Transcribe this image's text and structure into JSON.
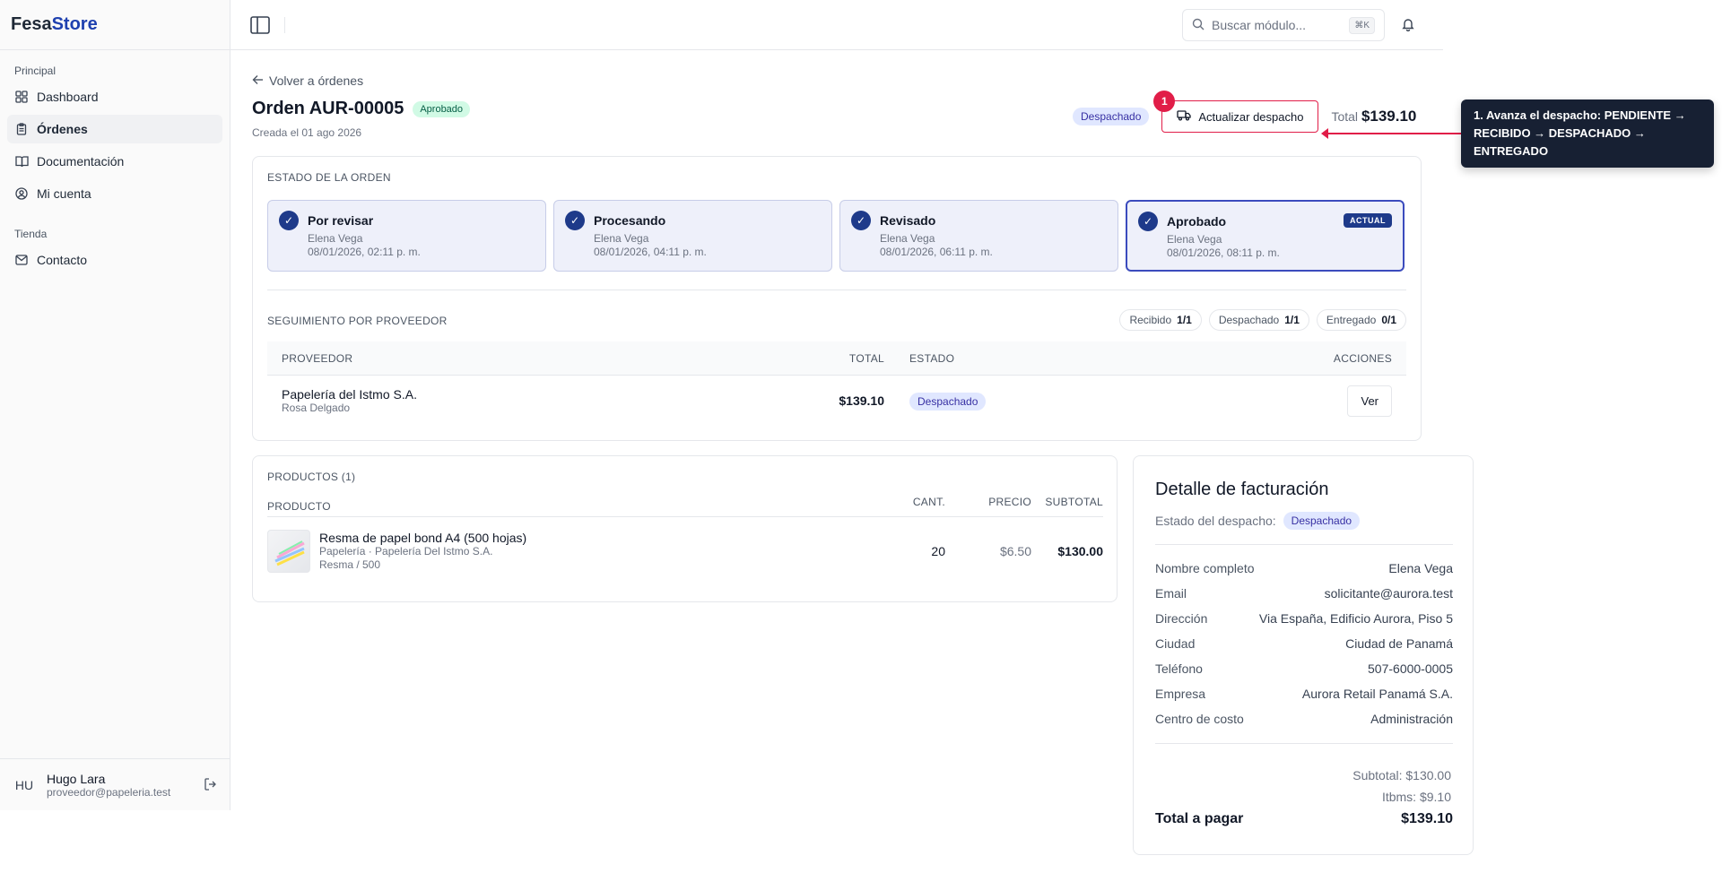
{
  "brand": {
    "part1": "Fesa",
    "part2": "Store"
  },
  "sidebar": {
    "group1_label": "Principal",
    "group1_items": [
      {
        "label": "Dashboard",
        "icon": "grid-icon"
      },
      {
        "label": "Órdenes",
        "icon": "clipboard-icon",
        "active": true
      },
      {
        "label": "Documentación",
        "icon": "book-icon"
      },
      {
        "label": "Mi cuenta",
        "icon": "user-circle-icon"
      }
    ],
    "group2_label": "Tienda",
    "group2_items": [
      {
        "label": "Contacto",
        "icon": "mail-icon"
      }
    ]
  },
  "user": {
    "initials": "HU",
    "name": "Hugo Lara",
    "email": "proveedor@papeleria.test"
  },
  "topbar": {
    "search_placeholder": "Buscar módulo...",
    "search_shortcut": "⌘K"
  },
  "header": {
    "back_label": "Volver a órdenes",
    "order_title": "Orden AUR-00005",
    "order_badge": "Aprobado",
    "created": "Creada el 01 ago 2026",
    "dispatch_badge": "Despachado",
    "update_button": "Actualizar despacho",
    "step_number": "1",
    "total_label": "Total",
    "total_value": "$139.10"
  },
  "tooltip": {
    "text": "1. Avanza el despacho: PENDIENTE → RECIBIDO → DESPACHADO → ENTREGADO"
  },
  "order_status": {
    "section_label": "Estado de la orden",
    "current_label": "ACTUAL",
    "steps": [
      {
        "title": "Por revisar",
        "user": "Elena Vega",
        "date": "08/01/2026, 02:11 p. m."
      },
      {
        "title": "Procesando",
        "user": "Elena Vega",
        "date": "08/01/2026, 04:11 p. m."
      },
      {
        "title": "Revisado",
        "user": "Elena Vega",
        "date": "08/01/2026, 06:11 p. m."
      },
      {
        "title": "Aprobado",
        "user": "Elena Vega",
        "date": "08/01/2026, 08:11 p. m."
      }
    ]
  },
  "vendor_tracking": {
    "section_label": "Seguimiento por proveedor",
    "counters": [
      {
        "label": "Recibido",
        "value": "1/1"
      },
      {
        "label": "Despachado",
        "value": "1/1"
      },
      {
        "label": "Entregado",
        "value": "0/1"
      }
    ],
    "columns": {
      "proveedor": "Proveedor",
      "total": "Total",
      "estado": "Estado",
      "acciones": "Acciones"
    },
    "rows": [
      {
        "name": "Papelería del Istmo S.A.",
        "contact": "Rosa Delgado",
        "total": "$139.10",
        "status": "Despachado",
        "action": "Ver"
      }
    ]
  },
  "products": {
    "section_label": "Productos (1)",
    "columns": {
      "producto": "Producto",
      "cant": "Cant.",
      "precio": "Precio",
      "subtotal": "Subtotal"
    },
    "rows": [
      {
        "name": "Resma de papel bond A4 (500 hojas)",
        "category": "Papelería · Papelería Del Istmo S.A.",
        "unit": "Resma / 500",
        "qty": "20",
        "price": "$6.50",
        "subtotal": "$130.00"
      }
    ]
  },
  "billing": {
    "title": "Detalle de facturación",
    "status_label": "Estado del despacho:",
    "status_badge": "Despachado",
    "rows": [
      {
        "k": "Nombre completo",
        "v": "Elena Vega"
      },
      {
        "k": "Email",
        "v": "solicitante@aurora.test"
      },
      {
        "k": "Dirección",
        "v": "Via España, Edificio Aurora, Piso 5"
      },
      {
        "k": "Ciudad",
        "v": "Ciudad de Panamá"
      },
      {
        "k": "Teléfono",
        "v": "507-6000-0005"
      },
      {
        "k": "Empresa",
        "v": "Aurora Retail Panamá S.A."
      },
      {
        "k": "Centro de costo",
        "v": "Administración"
      }
    ],
    "subtotal": "Subtotal: $130.00",
    "tax": "Itbms: $9.10",
    "total_label": "Total a pagar",
    "total_value": "$139.10"
  }
}
